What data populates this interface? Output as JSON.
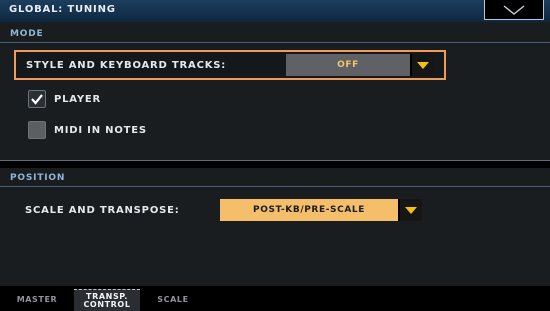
{
  "header": {
    "title": "GLOBAL: TUNING",
    "menu_icon": "chevron-down-icon"
  },
  "mode": {
    "section_label": "MODE",
    "style_tracks": {
      "label": "STYLE AND KEYBOARD TRACKS:",
      "value": "OFF"
    },
    "player": {
      "label": "PLAYER",
      "checked": true
    },
    "midi_in_notes": {
      "label": "MIDI IN NOTES",
      "checked": false
    }
  },
  "position": {
    "section_label": "POSITION",
    "scale_transpose": {
      "label": "SCALE AND TRANSPOSE:",
      "value": "POST-KB/PRE-SCALE"
    }
  },
  "tabs": [
    {
      "label": "MASTER",
      "active": false
    },
    {
      "label_line1": "TRANSP.",
      "label_line2": "CONTROL",
      "active": true
    },
    {
      "label": "SCALE",
      "active": false
    }
  ],
  "colors": {
    "accent": "#f09a5c",
    "value_box": "#f4be6a",
    "arrow": "#f1c11a",
    "section_text": "#8fb4d8"
  }
}
